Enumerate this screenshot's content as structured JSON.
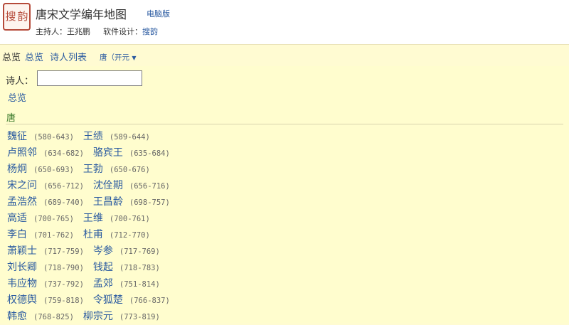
{
  "header": {
    "seal_chars": [
      "搜",
      "韵"
    ],
    "site_title": "唐宋文学编年地图",
    "edition_link": "电脑版",
    "host_label": "主持人：王兆鹏",
    "designer_label": "软件设计：",
    "designer_name": "搜韵"
  },
  "nav": {
    "overview_current": "总览",
    "overview_link": "总览",
    "poet_list_link": "诗人列表",
    "dynasty_selector": "唐（开元"
  },
  "search": {
    "label": "诗人：",
    "value": "",
    "overview_link": "总览"
  },
  "dynasty_title": "唐",
  "poets": [
    [
      {
        "name": "魏征",
        "years": "(580-643)"
      },
      {
        "name": "王绩",
        "years": "(589-644)"
      }
    ],
    [
      {
        "name": "卢照邻",
        "years": "(634-682)"
      },
      {
        "name": "骆宾王",
        "years": "(635-684)"
      }
    ],
    [
      {
        "name": "杨炯",
        "years": "(650-693)"
      },
      {
        "name": "王勃",
        "years": "(650-676)"
      }
    ],
    [
      {
        "name": "宋之问",
        "years": "(656-712)"
      },
      {
        "name": "沈佺期",
        "years": "(656-716)"
      }
    ],
    [
      {
        "name": "孟浩然",
        "years": "(689-740)"
      },
      {
        "name": "王昌龄",
        "years": "(698-757)"
      }
    ],
    [
      {
        "name": "高适",
        "years": "(700-765)"
      },
      {
        "name": "王维",
        "years": "(700-761)"
      }
    ],
    [
      {
        "name": "李白",
        "years": "(701-762)"
      },
      {
        "name": "杜甫",
        "years": "(712-770)"
      }
    ],
    [
      {
        "name": "萧颖士",
        "years": "(717-759)"
      },
      {
        "name": "岑参",
        "years": "(717-769)"
      }
    ],
    [
      {
        "name": "刘长卿",
        "years": "(718-790)"
      },
      {
        "name": "钱起",
        "years": "(718-783)"
      }
    ],
    [
      {
        "name": "韦应物",
        "years": "(737-792)"
      },
      {
        "name": "孟郊",
        "years": "(751-814)"
      }
    ],
    [
      {
        "name": "权德舆",
        "years": "(759-818)"
      },
      {
        "name": "令狐楚",
        "years": "(766-837)"
      }
    ],
    [
      {
        "name": "韩愈",
        "years": "(768-825)"
      },
      {
        "name": "柳宗元",
        "years": "(773-819)"
      }
    ]
  ]
}
